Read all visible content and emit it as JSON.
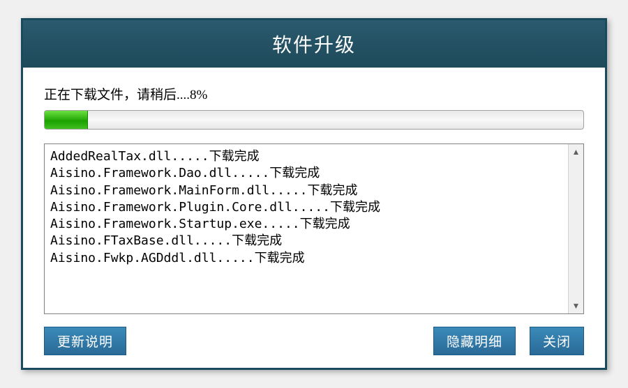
{
  "title": "软件升级",
  "status": {
    "prefix": "正在下载文件，请稍后....",
    "percent_text": "8%",
    "percent_value": 8
  },
  "log_lines": [
    "AddedRealTax.dll.....下载完成",
    "Aisino.Framework.Dao.dll.....下载完成",
    "Aisino.Framework.MainForm.dll.....下载完成",
    "Aisino.Framework.Plugin.Core.dll.....下载完成",
    "Aisino.Framework.Startup.exe.....下载完成",
    "Aisino.FTaxBase.dll.....下载完成",
    "Aisino.Fwkp.AGDddl.dll.....下载完成"
  ],
  "buttons": {
    "update_notes": "更新说明",
    "hide_details": "隐藏明细",
    "close": "关闭"
  }
}
